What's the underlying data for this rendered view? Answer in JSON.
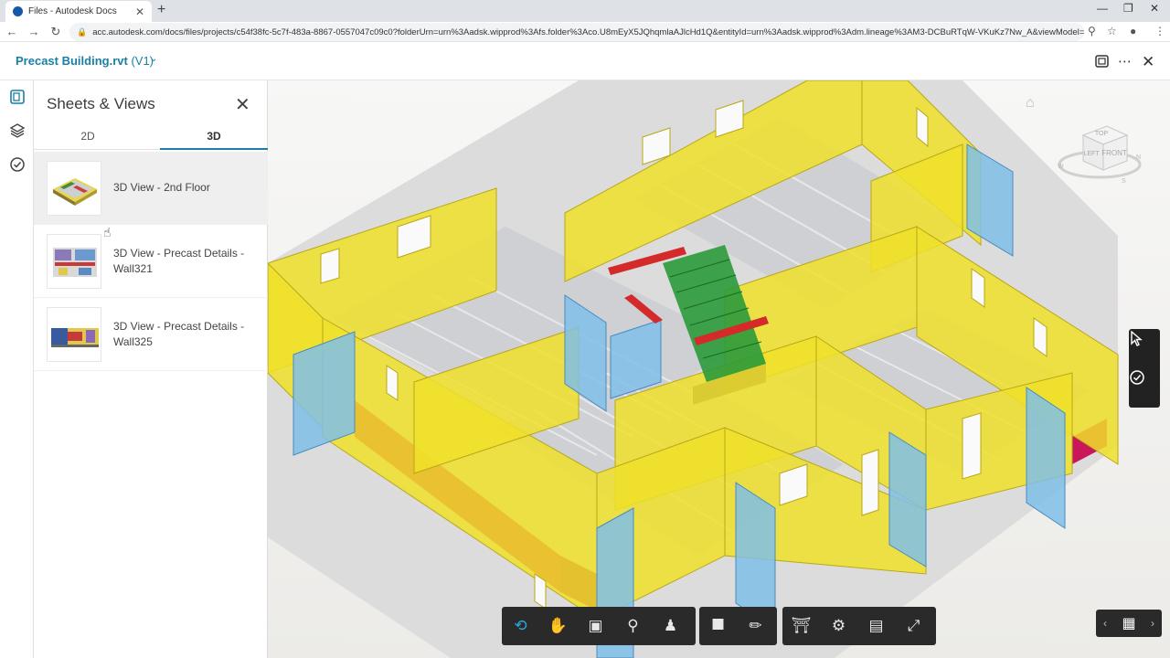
{
  "browser": {
    "tab_title": "Files - Autodesk Docs",
    "tab_close": "✕",
    "new_tab": "+",
    "url": "acc.autodesk.com/docs/files/projects/c54f38fc-5c7f-483a-8867-0557047c09c0?folderUrn=urn%3Aadsk.wipprod%3Afs.folder%3Aco.U8mEyX5JQhqmlaAJlcHd1Q&entityId=urn%3Aadsk.wipprod%3Adm.lineage%3AM3-DCBuRTqW-VKuKz7Nw_A&viewModel=detail...",
    "back": "←",
    "forward": "→",
    "reload": "↻",
    "minimize": "—",
    "maximize": "❐",
    "close": "✕"
  },
  "header": {
    "file_name": "Precast Building.rvt",
    "version": "(V1)",
    "caret": "⌄"
  },
  "panel": {
    "title": "Sheets & Views",
    "close": "✕",
    "tabs": [
      {
        "label": "2D"
      },
      {
        "label": "3D"
      }
    ],
    "items": [
      {
        "label": "3D View - 2nd Floor"
      },
      {
        "label": "3D View - Precast Details - Wall321"
      },
      {
        "label": "3D View - Precast Details - Wall325"
      }
    ]
  },
  "viewcube": {
    "top": "TOP",
    "left": "LEFT",
    "front": "FRONT",
    "n": "N",
    "w": "W",
    "s": "S"
  },
  "colors": {
    "accent": "#1a7fa3",
    "wall_yellow": "#f0e02a",
    "wall_blue": "#7fbfe8",
    "beam_red": "#d42a2a",
    "stair_green": "#2a9a3a",
    "footing_magenta": "#c8185a",
    "toolbar_bg": "#2a2a2a",
    "tool_active": "#2aa7df"
  }
}
